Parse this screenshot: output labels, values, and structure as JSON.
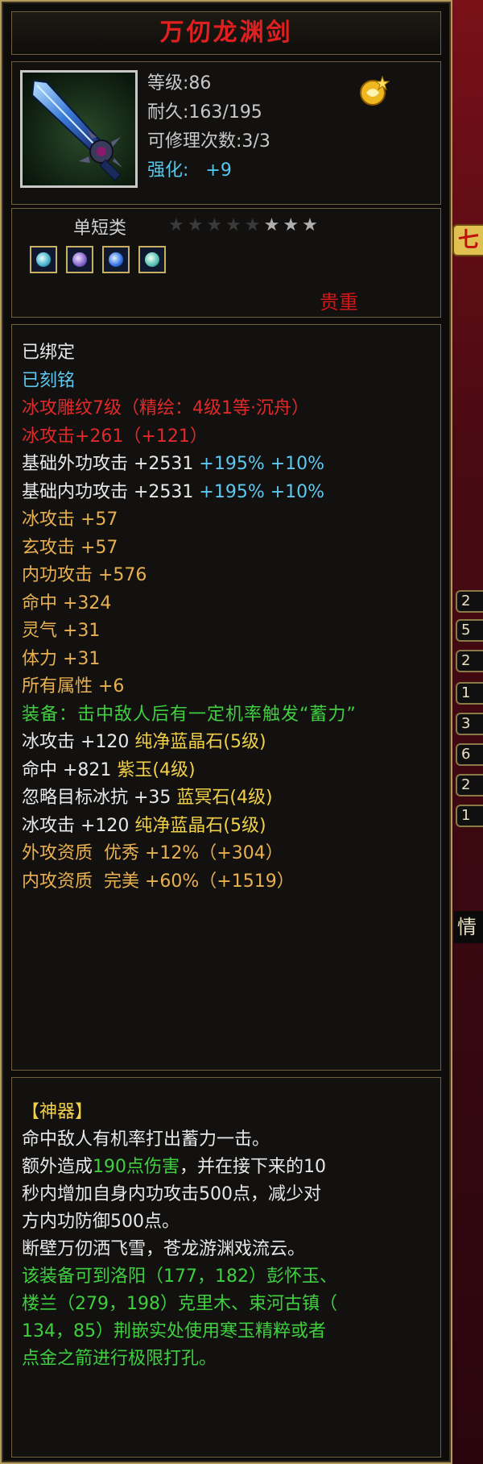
{
  "item": {
    "name": "万仞龙渊剑",
    "level": "等级:86",
    "durability": "耐久:163/195",
    "repair": "可修理次数:3/3",
    "enhance_label": "强化:",
    "enhance_value": "+9",
    "category": "单短类",
    "stars_dim": "★★★★★",
    "stars_lit": "★★★",
    "rarity": "贵重",
    "gems": [
      "gem-icon",
      "gem-icon",
      "gem-icon",
      "gem-icon"
    ]
  },
  "attributes": [
    {
      "text": "已绑定",
      "color": "#e8e8e8"
    },
    {
      "text": "已刻铭",
      "color": "#5ec8f0"
    }
  ],
  "engrave": {
    "line1": "冰攻雕纹7级（精绘：4级1等·沉舟）",
    "line2": "冰攻击+261（+121）"
  },
  "base": [
    {
      "label": "基础外功攻击 +2531 ",
      "bonus": "+195% +10%"
    },
    {
      "label": "基础内功攻击 +2531 ",
      "bonus": "+195% +10%"
    }
  ],
  "stats": [
    "冰攻击 +57",
    "玄攻击 +57",
    "内功攻击 +576",
    "命中 +324",
    "灵气 +31",
    "体力 +31",
    "所有属性 +6"
  ],
  "equip_effect": "装备：击中敌人后有一定机率触发“蓄力”",
  "inlays": [
    {
      "stat": "冰攻击 +120 ",
      "gem": "纯净蓝晶石(5级)"
    },
    {
      "stat": "命中 +821 ",
      "gem": "紫玉(4级)"
    },
    {
      "stat": "忽略目标冰抗 +35 ",
      "gem": "蓝冥石(4级)"
    },
    {
      "stat": "冰攻击 +120 ",
      "gem": "纯净蓝晶石(5级)"
    }
  ],
  "qualities": [
    "外攻资质  优秀 +12%（+304）",
    "内攻资质  完美 +60%（+1519）"
  ],
  "lore": {
    "header": "【神器】",
    "l1": "命中敌人有机率打出蓄力一击。",
    "l2a": "额外造成",
    "l2b": "190点伤害",
    "l2c": "，并在接下来的10",
    "l3": "秒内增加自身内功攻击500点，减少对",
    "l4": "方内功防御500点。",
    "l5": "断壁万仞洒飞雪，苍龙游渊戏流云。",
    "g1": "该装备可到洛阳（177，182）彭怀玉、",
    "g2": "楼兰（279，198）克里木、束河古镇（",
    "g3": "134，85）荆嵌实处使用寒玉精粹或者",
    "g4": "点金之箭进行极限打孔。"
  },
  "background": {
    "tab_text": "七",
    "chips": [
      "2",
      "5",
      "2",
      "1",
      "3",
      "6",
      "2",
      "1"
    ],
    "bottom_tab": "情"
  }
}
